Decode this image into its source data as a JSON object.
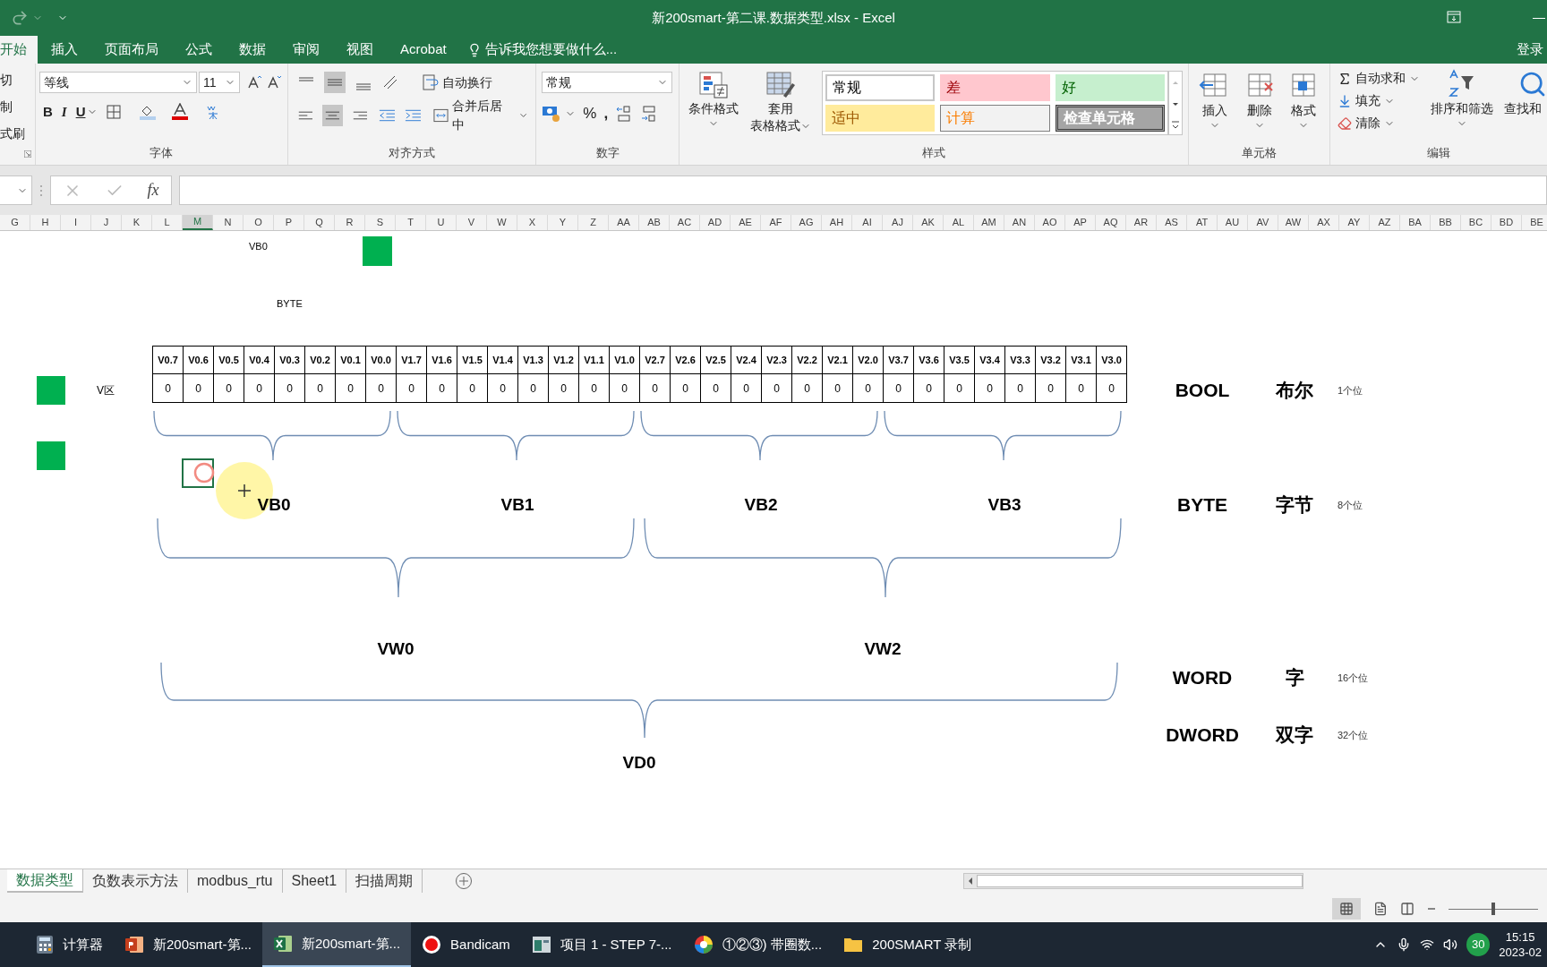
{
  "window": {
    "title": "新200smart-第二课.数据类型.xlsx - Excel"
  },
  "ribbon_tabs": [
    {
      "label": "开始",
      "selected": true
    },
    {
      "label": "插入",
      "selected": false
    },
    {
      "label": "页面布局",
      "selected": false
    },
    {
      "label": "公式",
      "selected": false
    },
    {
      "label": "数据",
      "selected": false
    },
    {
      "label": "审阅",
      "selected": false
    },
    {
      "label": "视图",
      "selected": false
    },
    {
      "label": "Acrobat",
      "selected": false
    }
  ],
  "tell_me": "告诉我您想要做什么...",
  "sign_in": "登录",
  "ribbon": {
    "clipboard": [
      "切",
      "制",
      "式刷"
    ],
    "font": {
      "name": "等线",
      "size": "11",
      "bold": "B",
      "italic": "I",
      "underline": "U",
      "label": "字体"
    },
    "alignment": {
      "wrap": "自动换行",
      "merge": "合并后居中",
      "label": "对齐方式"
    },
    "number": {
      "format": "常规",
      "percent": "%",
      "comma": ",",
      "label": "数字"
    },
    "styles": {
      "conditional": "条件格式",
      "table": [
        "套用",
        "表格格式"
      ],
      "cells": [
        {
          "label": "常规",
          "kind": "normal"
        },
        {
          "label": "差",
          "kind": "bad"
        },
        {
          "label": "好",
          "kind": "good"
        },
        {
          "label": "适中",
          "kind": "neutral"
        },
        {
          "label": "计算",
          "kind": "calculation"
        },
        {
          "label": "检查单元格",
          "kind": "check"
        }
      ],
      "label": "样式"
    },
    "cells": {
      "buttons": [
        "插入",
        "删除",
        "格式"
      ],
      "label": "单元格"
    },
    "editing": {
      "autosum": "自动求和",
      "fill": "填充",
      "clear": "清除",
      "sort": "排序和筛选",
      "find": "查找和",
      "label": "编辑"
    }
  },
  "formula_bar": {
    "fx": "fx"
  },
  "columns": [
    {
      "label": "G",
      "selected": false
    },
    {
      "label": "H",
      "selected": false
    },
    {
      "label": "I",
      "selected": false
    },
    {
      "label": "J",
      "selected": false
    },
    {
      "label": "K",
      "selected": false
    },
    {
      "label": "L",
      "selected": false
    },
    {
      "label": "M",
      "selected": true
    },
    {
      "label": "N",
      "selected": false
    },
    {
      "label": "O",
      "selected": false
    },
    {
      "label": "P",
      "selected": false
    },
    {
      "label": "Q",
      "selected": false
    },
    {
      "label": "R",
      "selected": false
    },
    {
      "label": "S",
      "selected": false
    },
    {
      "label": "T",
      "selected": false
    },
    {
      "label": "U",
      "selected": false
    },
    {
      "label": "V",
      "selected": false
    },
    {
      "label": "W",
      "selected": false
    },
    {
      "label": "X",
      "selected": false
    },
    {
      "label": "Y",
      "selected": false
    },
    {
      "label": "Z",
      "selected": false
    },
    {
      "label": "AA",
      "selected": false
    },
    {
      "label": "AB",
      "selected": false
    },
    {
      "label": "AC",
      "selected": false
    },
    {
      "label": "AD",
      "selected": false
    },
    {
      "label": "AE",
      "selected": false
    },
    {
      "label": "AF",
      "selected": false
    },
    {
      "label": "AG",
      "selected": false
    },
    {
      "label": "AH",
      "selected": false
    },
    {
      "label": "AI",
      "selected": false
    },
    {
      "label": "AJ",
      "selected": false
    },
    {
      "label": "AK",
      "selected": false
    },
    {
      "label": "AL",
      "selected": false
    },
    {
      "label": "AM",
      "selected": false
    },
    {
      "label": "AN",
      "selected": false
    },
    {
      "label": "AO",
      "selected": false
    },
    {
      "label": "AP",
      "selected": false
    },
    {
      "label": "AQ",
      "selected": false
    },
    {
      "label": "AR",
      "selected": false
    },
    {
      "label": "AS",
      "selected": false
    },
    {
      "label": "AT",
      "selected": false
    },
    {
      "label": "AU",
      "selected": false
    },
    {
      "label": "AV",
      "selected": false
    },
    {
      "label": "AW",
      "selected": false
    },
    {
      "label": "AX",
      "selected": false
    },
    {
      "label": "AY",
      "selected": false
    },
    {
      "label": "AZ",
      "selected": false
    },
    {
      "label": "BA",
      "selected": false
    },
    {
      "label": "BB",
      "selected": false
    },
    {
      "label": "BC",
      "selected": false
    },
    {
      "label": "BD",
      "selected": false
    },
    {
      "label": "BE",
      "selected": false
    }
  ],
  "sheet": {
    "notes": [
      "VB0",
      "BYTE"
    ],
    "area_label": "V区",
    "bit_headers": [
      "V0.7",
      "V0.6",
      "V0.5",
      "V0.4",
      "V0.3",
      "V0.2",
      "V0.1",
      "V0.0",
      "V1.7",
      "V1.6",
      "V1.5",
      "V1.4",
      "V1.3",
      "V1.2",
      "V1.1",
      "V1.0",
      "V2.7",
      "V2.6",
      "V2.5",
      "V2.4",
      "V2.3",
      "V2.2",
      "V2.1",
      "V2.0",
      "V3.7",
      "V3.6",
      "V3.5",
      "V3.4",
      "V3.3",
      "V3.2",
      "V3.1",
      "V3.0"
    ],
    "bit_values": [
      "0",
      "0",
      "0",
      "0",
      "0",
      "0",
      "0",
      "0",
      "0",
      "0",
      "0",
      "0",
      "0",
      "0",
      "0",
      "0",
      "0",
      "0",
      "0",
      "0",
      "0",
      "0",
      "0",
      "0",
      "0",
      "0",
      "0",
      "0",
      "0",
      "0",
      "0",
      "0"
    ],
    "bytes": [
      "VB0",
      "VB1",
      "VB2",
      "VB3"
    ],
    "words": [
      "VW0",
      "VW2"
    ],
    "dwords": [
      "VD0"
    ],
    "legend": [
      {
        "type": "BOOL",
        "name": "布尔",
        "bits": "1个位"
      },
      {
        "type": "BYTE",
        "name": "字节",
        "bits": "8个位"
      },
      {
        "type": "WORD",
        "name": "字",
        "bits": "16个位"
      },
      {
        "type": "DWORD",
        "name": "双字",
        "bits": "32个位"
      }
    ]
  },
  "sheet_tabs": [
    {
      "label": "数据类型",
      "selected": true
    },
    {
      "label": "负数表示方法",
      "selected": false
    },
    {
      "label": "modbus_rtu",
      "selected": false
    },
    {
      "label": "Sheet1",
      "selected": false
    },
    {
      "label": "扫描周期",
      "selected": false
    }
  ],
  "taskbar": {
    "items": [
      {
        "label": "计算器",
        "kind": "calculator",
        "selected": false
      },
      {
        "label": "新200smart-第...",
        "kind": "powerpoint",
        "selected": false
      },
      {
        "label": "新200smart-第...",
        "kind": "excel",
        "selected": true
      },
      {
        "label": "Bandicam",
        "kind": "record",
        "selected": false
      },
      {
        "label": "项目 1 - STEP 7-...",
        "kind": "window",
        "selected": false
      },
      {
        "label": "①②③) 带圈数...",
        "kind": "color",
        "selected": false
      },
      {
        "label": "200SMART 录制",
        "kind": "folder",
        "selected": false
      }
    ],
    "badge": "30",
    "time": "15:15",
    "date": "2023-02"
  },
  "zoom": {
    "level": 0.5
  }
}
